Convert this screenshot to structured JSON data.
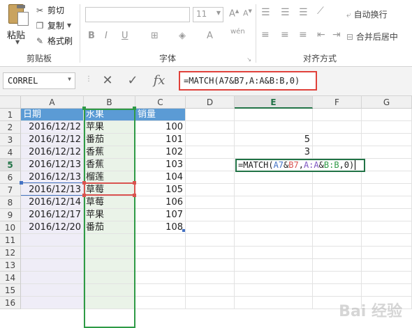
{
  "ribbon": {
    "clipboard": {
      "paste_label": "粘贴",
      "cut_label": "剪切",
      "copy_label": "复制",
      "format_painter_label": "格式刷",
      "group_label": "剪贴板"
    },
    "font": {
      "font_size": "11",
      "group_label": "字体"
    },
    "alignment": {
      "wrap_text_label": "自动换行",
      "merge_center_label": "合并后居中",
      "group_label": "对齐方式"
    }
  },
  "formula_bar": {
    "name_box": "CORREL",
    "formula": "=MATCH(A7&B7,A:A&B:B,0)"
  },
  "columns": [
    "A",
    "B",
    "C",
    "D",
    "E",
    "F",
    "G"
  ],
  "rows": [
    "1",
    "2",
    "3",
    "4",
    "5",
    "6",
    "7",
    "8",
    "9",
    "10",
    "11",
    "12",
    "13",
    "14",
    "15",
    "16"
  ],
  "table": {
    "headers": [
      "日期",
      "水果",
      "销量"
    ],
    "rows": [
      [
        "2016/12/12",
        "苹果",
        "100"
      ],
      [
        "2016/12/12",
        "番茄",
        "101"
      ],
      [
        "2016/12/12",
        "香蕉",
        "102"
      ],
      [
        "2016/12/13",
        "香蕉",
        "103"
      ],
      [
        "2016/12/13",
        "榴莲",
        "104"
      ],
      [
        "2016/12/13",
        "草莓",
        "105"
      ],
      [
        "2016/12/14",
        "草莓",
        "106"
      ],
      [
        "2016/12/17",
        "苹果",
        "107"
      ],
      [
        "2016/12/20",
        "番茄",
        "108"
      ]
    ]
  },
  "column_e": {
    "E3": "5",
    "E4": "3",
    "E5_edit": {
      "prefix": "=MATCH(",
      "ref1": "A7",
      "amp1": "&",
      "ref2": "B7",
      "comma1": ",",
      "ref3": "A:A",
      "amp2": "&",
      "ref4": "B:B",
      "suffix": ",0)"
    }
  },
  "colors": {
    "header_fill": "#5b9bd5",
    "ref_a_color": "#4472c4",
    "ref_b_color": "#d9534f",
    "range_a_color": "#7e57c2",
    "range_b_color": "#2e9a46",
    "highlight_red": "#e0413a",
    "excel_green": "#217346"
  },
  "watermark": "Bai 经验"
}
